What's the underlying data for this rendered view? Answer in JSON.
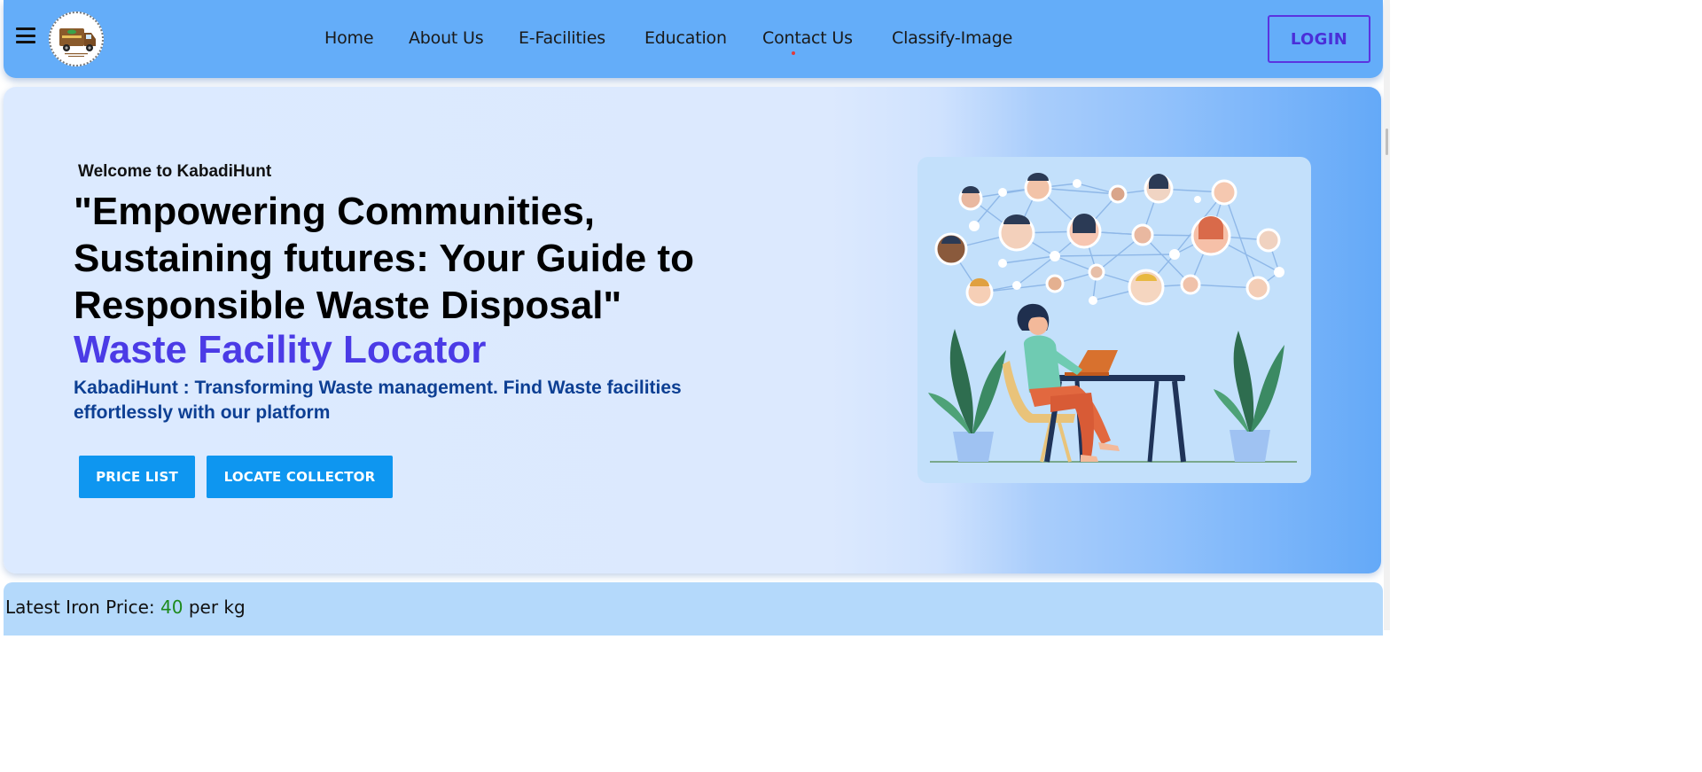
{
  "nav": {
    "links": [
      "Home",
      "About Us",
      "E-Facilities",
      "Education",
      "Contact Us",
      "Classify-Image"
    ],
    "login_label": "LOGIN",
    "logo_icon": "truck-logo-icon",
    "menu_icon": "hamburger-menu-icon"
  },
  "hero": {
    "welcome": "Welcome to KabadiHunt",
    "headline": "\"Empowering Communities, Sustaining futures: Your Guide to Responsible Waste Disposal\"",
    "locator_title": "Waste Facility Locator",
    "subtext": "KabadiHunt : Transforming Waste management. Find Waste facilities effortlessly with our platform",
    "buttons": {
      "price_list": "PRICE LIST",
      "locate_collector": "LOCATE COLLECTOR"
    },
    "illustration_icon": "networking-woman-laptop-illustration"
  },
  "price_bar": {
    "label": "Latest Iron Price:",
    "value": "40",
    "unit": "per kg"
  },
  "colors": {
    "navbar": "#64adf9",
    "accent_purple": "#4b3be6",
    "button_blue": "#0e96f0",
    "subtext_blue": "#0d3f93",
    "price_green": "#1d8a1d"
  }
}
